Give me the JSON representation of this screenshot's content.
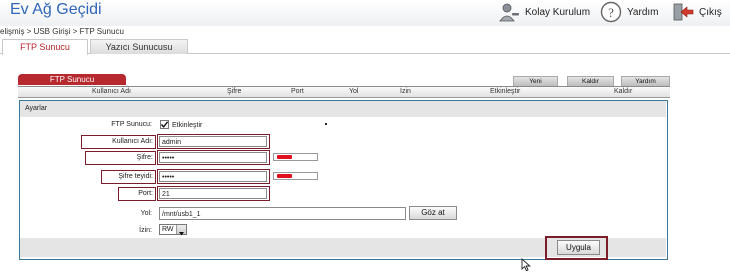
{
  "header": {
    "title": "Ev Ağ Geçidi",
    "quick_setup": "Kolay Kurulum",
    "help": "Yardım",
    "logout": "Çıkış"
  },
  "breadcrumb": "elişmiş > USB Girişi > FTP Sunucu",
  "tabs": [
    {
      "label": "FTP Sunucu",
      "active": true
    },
    {
      "label": "Yazıcı Sunucusu",
      "active": false
    }
  ],
  "panel": {
    "title": "FTP Sunucu",
    "toolbar": {
      "new": "Yeni",
      "remove": "Kaldır",
      "help": "Yardım"
    },
    "columns": [
      "Kullanıcı Adı",
      "Şifre",
      "Port",
      "Yol",
      "İzin",
      "Etkinleştir",
      "Kaldır"
    ]
  },
  "settings": {
    "section_title": "Ayarlar",
    "ftp_server_label": "FTP Sunucu:",
    "enable_label": "Etkinleştir",
    "enable_checked": true,
    "username_label": "Kullanıcı Adı:",
    "username_value": "admin",
    "password_label": "Şifre:",
    "password_value": "•••••",
    "confirm_label": "Şifre teyidi:",
    "confirm_value": "•••••",
    "port_label": "Port:",
    "port_value": "21",
    "path_label": "Yol:",
    "path_value": "/mnt/usb1_1",
    "browse_label": "Göz at",
    "permission_label": "İzin:",
    "permission_value": "RW",
    "apply_label": "Uygula"
  },
  "colors": {
    "accent_red": "#b5292f",
    "highlight_box": "#7b1c2b",
    "title_blue": "#2f65b8",
    "panel_border": "#3a7898",
    "strength_red": "#e01020"
  },
  "icons": {
    "quick_setup": "wrench-person-icon",
    "help": "question-circle-icon",
    "logout": "door-exit-icon",
    "checkbox": "checkmark-icon",
    "dropdown": "triangle-down-icon",
    "cursor": "mouse-pointer-icon"
  }
}
